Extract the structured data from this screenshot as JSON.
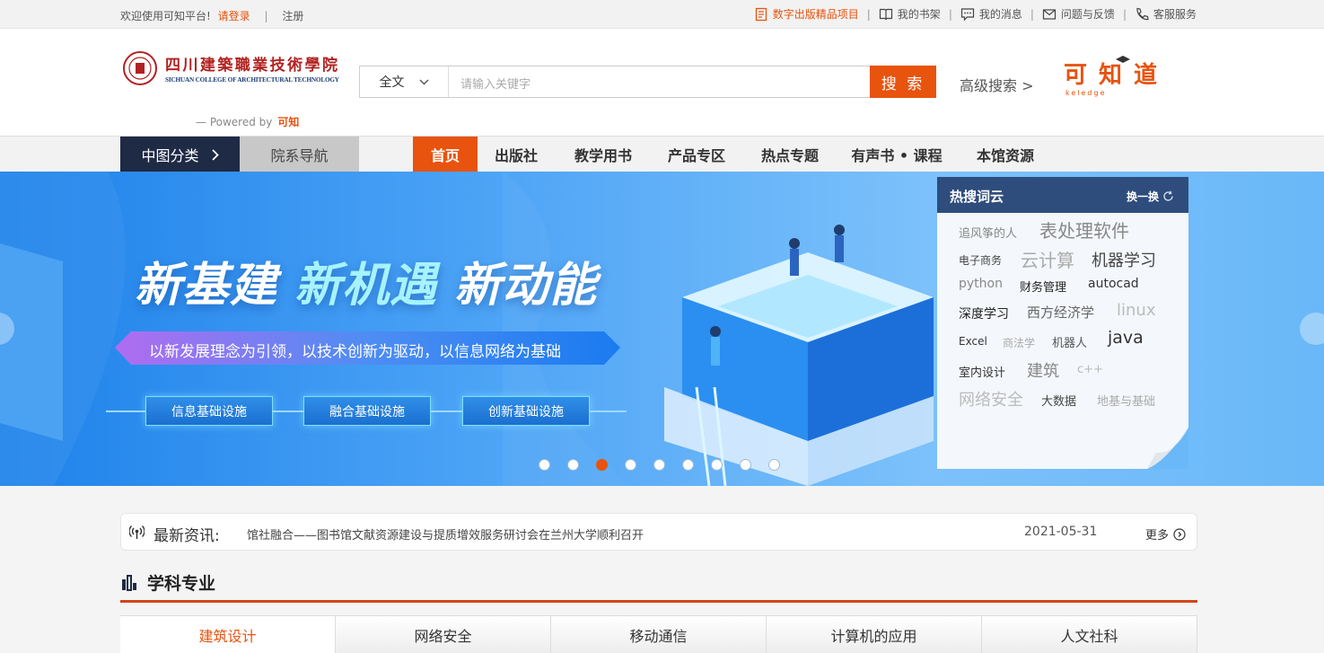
{
  "topbar": {
    "welcome": "欢迎使用可知平台!",
    "login": "请登录",
    "register": "注册",
    "links": [
      {
        "label": "数字出版精品项目",
        "icon": "document-icon"
      },
      {
        "label": "我的书架",
        "icon": "book-icon"
      },
      {
        "label": "我的消息",
        "icon": "message-icon"
      },
      {
        "label": "问题与反馈",
        "icon": "mail-icon"
      },
      {
        "label": "客服服务",
        "icon": "phone-icon"
      }
    ]
  },
  "header": {
    "institution_name": "四川建築職業技術學院",
    "institution_name_en": "SICHUAN COLLEGE OF ARCHITECTURAL TECHNOLOGY",
    "powered_by": "Powered by",
    "powered_brand": "可知",
    "search_scope": "全文",
    "search_placeholder": "请输入关键字",
    "search_button": "搜 索",
    "advanced_search": "高级搜索 >",
    "brand_logo_text": "可知道",
    "brand_logo_sub": "keledge"
  },
  "nav": {
    "classification": "中图分类",
    "department": "院系导航",
    "items": [
      "首页",
      "出版社",
      "教学用书",
      "产品专区",
      "热点专题",
      "有声书 • 课程",
      "本馆资源"
    ]
  },
  "banner": {
    "headline_parts": [
      "新基建 ",
      "新机遇 ",
      "新动能"
    ],
    "subtitle": "以新发展理念为引领，以技术创新为驱动，以信息网络为基础",
    "pills": [
      "信息基础设施",
      "融合基础设施",
      "创新基础设施"
    ],
    "dot_count": 9,
    "active_dot": 2
  },
  "hot_search": {
    "title": "热搜词云",
    "refresh": "换一换",
    "words": [
      "追风筝的人",
      "表处理软件",
      "电子商务",
      "云计算",
      "机器学习",
      "python",
      "财务管理",
      "autocad",
      "深度学习",
      "西方经济学",
      "linux",
      "Excel",
      "商法学",
      "机器人",
      "java",
      "室内设计",
      "建筑",
      "c++",
      "网络安全",
      "大数据",
      "地基与基础"
    ]
  },
  "news": {
    "label": "最新资讯:",
    "headline": "馆社融合——图书馆文献资源建设与提质增效服务研讨会在兰州大学顺利召开",
    "date": "2021-05-31",
    "more": "更多"
  },
  "subjects": {
    "title": "学科专业",
    "tabs": [
      "建筑设计",
      "网络安全",
      "移动通信",
      "计算机的应用",
      "人文社科"
    ],
    "active_tab": 0
  },
  "colors": {
    "accent": "#e8530e",
    "nav_dark": "#1f2a45",
    "hot_header": "#2e4d7c"
  }
}
